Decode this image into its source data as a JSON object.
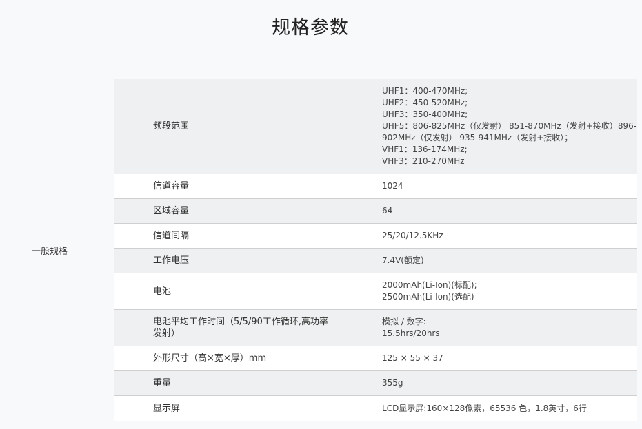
{
  "title": "规格参数",
  "group": "一般规格",
  "rows": [
    {
      "name": "频段范围",
      "lines": [
        "UHF1：400-470MHz;",
        "UHF2：450-520MHz;",
        "UHF3：350-400MHz;",
        "UHF5：806-825MHz（仅发射） 851-870MHz（发射+接收）896-",
        "902MHz（仅发射） 935-941MHz（发射+接收）；",
        "VHF1：136-174MHz;",
        "VHF3：210-270MHz"
      ]
    },
    {
      "name": "信道容量",
      "lines": [
        "1024"
      ]
    },
    {
      "name": "区域容量",
      "lines": [
        "64"
      ]
    },
    {
      "name": "信道间隔",
      "lines": [
        "25/20/12.5KHz"
      ]
    },
    {
      "name": "工作电压",
      "lines": [
        "7.4V(额定)"
      ]
    },
    {
      "name": "电池",
      "lines": [
        "2000mAh(Li-Ion)(标配);",
        "2500mAh(Li-Ion)(选配)"
      ]
    },
    {
      "name": "电池平均工作时间（5/5/90工作循环,高功率发射）",
      "lines": [
        "模拟 / 数字:",
        "15.5hrs/20hrs"
      ]
    },
    {
      "name": "外形尺寸（高×宽×厚）mm",
      "lines": [
        "125 × 55 × 37"
      ]
    },
    {
      "name": "重量",
      "lines": [
        "355g"
      ]
    },
    {
      "name": "显示屏",
      "lines": [
        "LCD显示屏:160×128像素，65536 色，1.8英寸，6行"
      ]
    }
  ]
}
